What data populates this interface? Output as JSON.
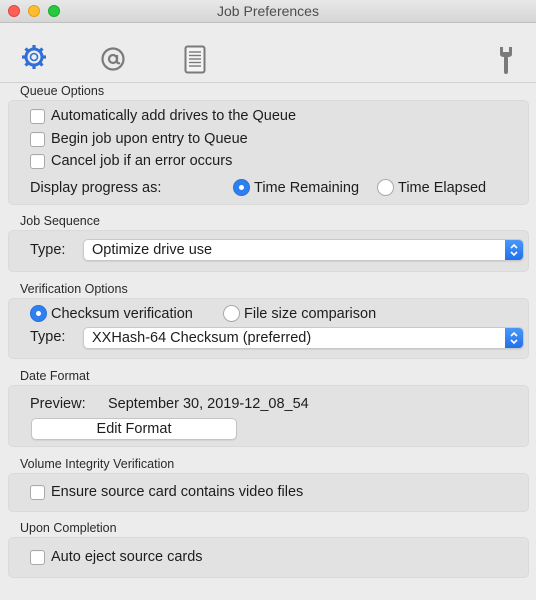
{
  "window": {
    "title": "Job Preferences"
  },
  "toolbar": {
    "icons": [
      "gear-icon",
      "at-sign-icon",
      "document-icon",
      "wrench-icon"
    ]
  },
  "colors": {
    "accent": "#2f7ff0",
    "panel": "#e2e2e2",
    "window": "#ececec"
  },
  "queue_options": {
    "label": "Queue Options",
    "auto_add": "Automatically add drives to the Queue",
    "begin_job": "Begin job upon entry to Queue",
    "cancel_job": "Cancel job if an error occurs",
    "progress_label": "Display progress as:",
    "time_remaining": "Time Remaining",
    "time_elapsed": "Time Elapsed",
    "selected_progress": "Time Remaining"
  },
  "job_sequence": {
    "label": "Job Sequence",
    "type_label": "Type:",
    "type_value": "Optimize drive use"
  },
  "verification_options": {
    "label": "Verification Options",
    "checksum": "Checksum verification",
    "file_size": "File size comparison",
    "selected": "Checksum verification",
    "type_label": "Type:",
    "type_value": "XXHash-64 Checksum (preferred)"
  },
  "date_format": {
    "label": "Date Format",
    "preview_label": "Preview:",
    "preview_value": "September 30, 2019-12_08_54",
    "edit_button": "Edit Format"
  },
  "volume_integrity": {
    "label": "Volume Integrity Verification",
    "ensure_video": "Ensure source card contains video files"
  },
  "upon_completion": {
    "label": "Upon Completion",
    "auto_eject": "Auto eject source cards"
  }
}
